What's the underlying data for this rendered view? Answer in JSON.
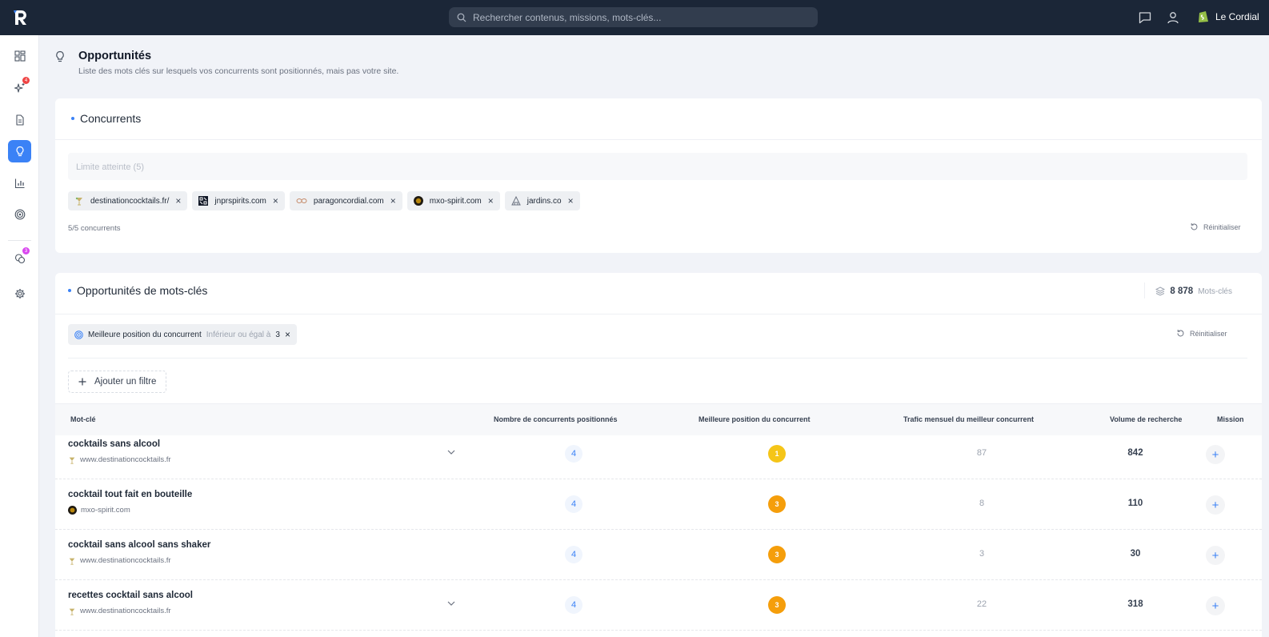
{
  "header": {
    "search_placeholder": "Rechercher contenus, missions, mots-clés...",
    "account_name": "Le Cordial"
  },
  "sidebar": {
    "items": [
      {
        "icon": "dashboard-icon"
      },
      {
        "icon": "sparkles-icon",
        "badge": "4",
        "badge_color": "#ef4444"
      },
      {
        "icon": "document-icon"
      },
      {
        "icon": "lightbulb-icon",
        "active": true
      },
      {
        "icon": "bar-chart-icon"
      },
      {
        "icon": "target-icon"
      },
      {
        "icon": "coins-icon",
        "badge": "3",
        "badge_color": "#d946ef"
      },
      {
        "icon": "gear-icon"
      }
    ]
  },
  "page": {
    "title": "Opportunités",
    "subtitle": "Liste des mots clés sur lesquels vos concurrents sont positionnés, mais pas votre site."
  },
  "competitors": {
    "title": "Concurrents",
    "input_placeholder": "Limite atteinte (5)",
    "chips": [
      {
        "name": "destinationcocktails.fr/",
        "icon": "cocktail-glass-icon"
      },
      {
        "name": "jnprspirits.com",
        "icon": "jnpr-logo-icon"
      },
      {
        "name": "paragoncordial.com",
        "icon": "paragon-logo-icon"
      },
      {
        "name": "mxo-spirit.com",
        "icon": "mxo-logo-icon"
      },
      {
        "name": "jardins.co",
        "icon": "jardins-logo-icon"
      }
    ],
    "count_text": "5/5 concurrents",
    "reset_label": "Réinitialiser"
  },
  "opportunities": {
    "title": "Opportunités de mots-clés",
    "keyword_count": "8 878",
    "keyword_count_label": "Mots-clés",
    "filter": {
      "field": "Meilleure position du concurrent",
      "operator": "Inférieur ou égal à",
      "value": "3"
    },
    "reset_label": "Réinitialiser",
    "add_filter_label": "Ajouter un filtre",
    "columns": {
      "keyword": "Mot-clé",
      "competitors": "Nombre de concurrents positionnés",
      "best_position": "Meilleure position du concurrent",
      "traffic": "Trafic mensuel du meilleur concurrent",
      "volume": "Volume de recherche",
      "mission": "Mission"
    },
    "rows": [
      {
        "keyword": "cocktails sans alcool",
        "site": "www.destinationcocktails.fr",
        "site_icon": "cocktail-glass-icon",
        "expandable": true,
        "competitors": "4",
        "position": "1",
        "position_color": "#f5c518",
        "traffic": "87",
        "volume": "842"
      },
      {
        "keyword": "cocktail tout fait en bouteille",
        "site": "mxo-spirit.com",
        "site_icon": "mxo-logo-icon",
        "expandable": false,
        "competitors": "4",
        "position": "3",
        "position_color": "#f59e0b",
        "traffic": "8",
        "volume": "110"
      },
      {
        "keyword": "cocktail sans alcool sans shaker",
        "site": "www.destinationcocktails.fr",
        "site_icon": "cocktail-glass-icon",
        "expandable": false,
        "competitors": "4",
        "position": "3",
        "position_color": "#f59e0b",
        "traffic": "3",
        "volume": "30"
      },
      {
        "keyword": "recettes cocktail sans alcool",
        "site": "www.destinationcocktails.fr",
        "site_icon": "cocktail-glass-icon",
        "expandable": true,
        "competitors": "4",
        "position": "3",
        "position_color": "#f59e0b",
        "traffic": "22",
        "volume": "318"
      }
    ]
  }
}
